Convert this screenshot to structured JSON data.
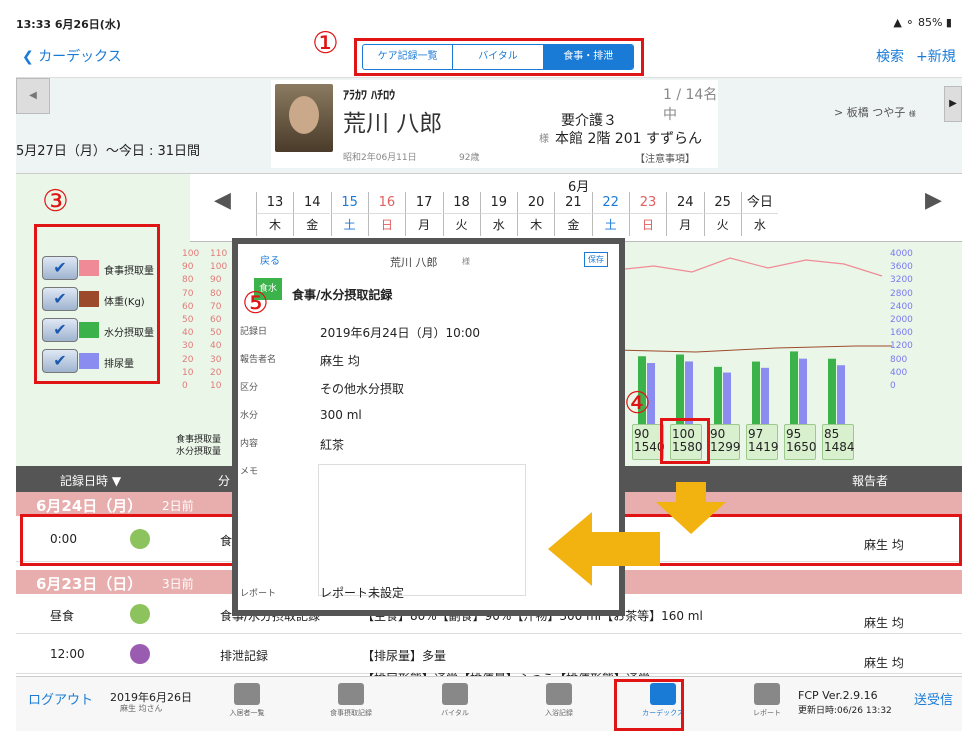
{
  "status": {
    "time": "13:33 6月26日(水)",
    "battery": "85%"
  },
  "nav": {
    "back": "カーデックス",
    "tabs": [
      "ケア記録一覧",
      "バイタル",
      "食事・排泄"
    ],
    "search": "検索",
    "new": "+新規"
  },
  "patient": {
    "kana": "ｱﾗｶﾜ ﾊﾁﾛｳ",
    "name": "荒川 八郎",
    "honorific": "様",
    "dob": "昭和2年06月11日",
    "age": "92歳",
    "count": "1 / 14名中",
    "care": "要介護３",
    "room": "本館 2階 201 すずらん",
    "note": "【注意事項】",
    "staff": "> 板橋 つや子",
    "staff_suffix": "様",
    "range": "5月27日（月）〜今日 : 31日間"
  },
  "dates": {
    "month": "6月",
    "days": [
      "13",
      "14",
      "15",
      "16",
      "17",
      "18",
      "19",
      "20",
      "21",
      "22",
      "23",
      "24",
      "25",
      "今日"
    ],
    "weekdays": [
      "木",
      "金",
      "土",
      "日",
      "月",
      "火",
      "水",
      "木",
      "金",
      "土",
      "日",
      "月",
      "火",
      "水"
    ]
  },
  "legend": [
    {
      "label": "食事摂取量",
      "color": "#f08a96"
    },
    {
      "label": "体重(Kg)",
      "color": "#9c4a2c"
    },
    {
      "label": "水分摂取量",
      "color": "#3cb34a"
    },
    {
      "label": "排尿量",
      "color": "#8a8cf0"
    }
  ],
  "axis": {
    "left1": [
      "100",
      "90",
      "80",
      "70",
      "60",
      "50",
      "40",
      "30",
      "20",
      "10",
      "0"
    ],
    "left2": [
      "110",
      "100",
      "90",
      "80",
      "70",
      "60",
      "50",
      "40",
      "30",
      "20",
      "10"
    ],
    "right": [
      "4000",
      "3600",
      "3200",
      "2800",
      "2400",
      "2000",
      "1600",
      "1200",
      "800",
      "400",
      "0"
    ]
  },
  "row_labels": [
    "食事摂取量",
    "水分摂取量"
  ],
  "values": [
    {
      "a": "90",
      "b": "1540"
    },
    {
      "a": "100",
      "b": "1580"
    },
    {
      "a": "90",
      "b": "1299"
    },
    {
      "a": "97",
      "b": "1419"
    },
    {
      "a": "95",
      "b": "1650"
    },
    {
      "a": "85",
      "b": "1484"
    }
  ],
  "list": {
    "headers": [
      "記録日時 ▼",
      "分",
      "報告者"
    ],
    "day1": {
      "date": "6月24日（月）",
      "ago": "2日前"
    },
    "row1": {
      "time": "0:00",
      "type": "食",
      "reporter": "麻生 均"
    },
    "day2": {
      "date": "6月23日（日）",
      "ago": "3日前"
    },
    "row2": {
      "time": "昼食",
      "type": "食事/水分摂取記録",
      "detail": "【主食】80%【副食】90%【汁物】300 ml【お茶等】160 ml",
      "reporter": "麻生 均"
    },
    "row3": {
      "time": "12:00",
      "type": "排泄記録",
      "detail": "【排尿量】多量",
      "reporter": "麻生 均"
    },
    "row4": {
      "detail": "【排尿形態】通常【排便量】ふつう【排便形態】通常"
    }
  },
  "tabbar": {
    "logout": "ログアウト",
    "date": "2019年6月26日",
    "user": "麻生 均さん",
    "tabs": [
      "入居者一覧",
      "食事摂取記録",
      "バイタル",
      "入浴記録",
      "カーデックス",
      "レポート"
    ],
    "version": "FCP Ver.2.9.16",
    "updated": "更新日時:06/26 13:32",
    "sync": "送受信"
  },
  "modal": {
    "back": "戻る",
    "name": "荒川 八郎",
    "hon": "様",
    "save": "保存",
    "icon": "食水",
    "title": "食事/水分摂取記録",
    "fields": [
      {
        "k": "記録日",
        "v": "2019年6月24日（月）10:00"
      },
      {
        "k": "報告者名",
        "v": "麻生 均"
      },
      {
        "k": "区分",
        "v": "その他水分摂取"
      },
      {
        "k": "水分",
        "v": "300 ml"
      },
      {
        "k": "内容",
        "v": "紅茶"
      },
      {
        "k": "メモ",
        "v": ""
      }
    ],
    "report_label": "レポート",
    "report_value": "レポート未設定"
  },
  "markers": [
    "①",
    "③",
    "④",
    "⑤"
  ],
  "chart_data": {
    "type": "bar",
    "categories": [
      "20",
      "21",
      "22",
      "23",
      "24",
      "25"
    ],
    "series": [
      {
        "name": "食事摂取量",
        "values": [
          90,
          100,
          90,
          97,
          95,
          85
        ]
      },
      {
        "name": "水分摂取量",
        "values": [
          1540,
          1580,
          1299,
          1419,
          1650,
          1484
        ]
      }
    ],
    "ylim_left": [
      0,
      100
    ],
    "ylim_right": [
      0,
      4000
    ]
  }
}
